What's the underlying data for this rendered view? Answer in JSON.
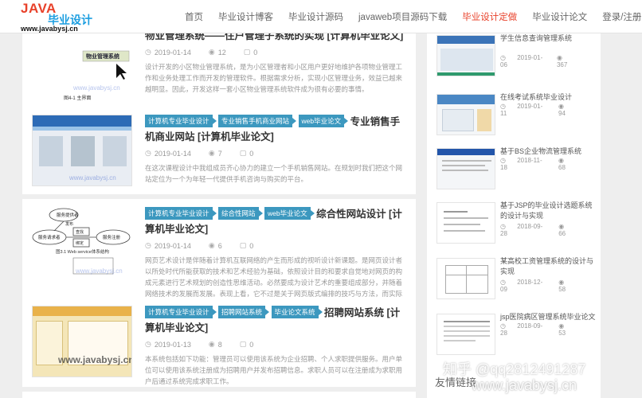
{
  "logo": {
    "brand": "JAVA",
    "name": "毕业设计",
    "site": "www.javabysj.cn"
  },
  "nav": [
    {
      "label": "首页"
    },
    {
      "label": "毕业设计博客"
    },
    {
      "label": "毕业设计源码"
    },
    {
      "label": "javaweb项目源码下载"
    },
    {
      "label": "毕业设计定做"
    },
    {
      "label": "毕业设计论文"
    },
    {
      "label": "登录/注册"
    }
  ],
  "accent": "#e8412a",
  "tag_color": "#3c98bf",
  "articles": [
    {
      "tags": [],
      "title": "物业管理系统——住户管理子系统的实现 [计算机毕业论文]",
      "date": "2019-01-14",
      "views": "12",
      "comments": "0",
      "excerpt": "设计开发的小区物业管理系统，是为小区管理者和小区用户更好地维护各项物业管理工作和业务处理工作而开发的管理软件。根据需求分析，实现小区管理业务，效益已越来越明显。因此，开发这样一套小区物业管理系统软件成为很有必要的事情。",
      "thumb_text": "物业管理系统",
      "thumb_caption": "图4-1 主界面"
    },
    {
      "tags": [
        "计算机专业毕业设计",
        "专业销售手机商业网站",
        "web毕业论文"
      ],
      "title": "专业销售手机商业网站 [计算机毕业论文]",
      "date": "2019-01-14",
      "views": "7",
      "comments": "0",
      "excerpt": "在这次课程设计中我组成员齐心协力的建立一个手机销售网站。在规划时我们把这个网站定位为一个为年轻一代提供手机咨询与购买的平台。"
    },
    {
      "tags": [
        "计算机专业毕业设计",
        "综合性网站",
        "web毕业论文"
      ],
      "title": "综合性网站设计 [计算机毕业论文]",
      "date": "2019-01-14",
      "views": "6",
      "comments": "0",
      "excerpt": "网页艺术设计是伴随着计算机互联网络的产生而形成的视听设计新课题。是网页设计者以所处时代所能获取的技术和艺术经验为基础，依照设计目的和要求自觉地对网页的构成元素进行艺术规划的创造性思维活动。必然要成为设计艺术的重要组成部分，并随着网络技术的发展而发展。表现上看，它不过是关于网页版式编排的技巧与方法，而实际上，它不仅是一种技能，更是艺术与技术的高度统一。",
      "thumb_labels": [
        "服务请求者",
        "服务提供者",
        "服务注册",
        "查找",
        "绑定",
        "发布"
      ],
      "thumb_caption": "图3.1 Web service体系结构"
    },
    {
      "tags": [
        "计算机专业毕业设计",
        "招聘网站系统",
        "毕业论文系统"
      ],
      "title": "招聘网站系统 [计算机毕业论文]",
      "date": "2019-01-13",
      "views": "8",
      "comments": "0",
      "excerpt": "本系统包括如下功能：管理员可以使用该系统为企业招聘、个人求职提供服务。用户单位可以使用该系统注册成为招聘用户并发布招聘信息。求职人员可以在注册成为求职用户后通过系统完成求职工作。"
    }
  ],
  "sidebar": [
    {
      "title": "学生信息查询管理系统",
      "date": "2019-01-06",
      "views": "367"
    },
    {
      "title": "在线考试系统毕业设计",
      "date": "2019-01-11",
      "views": "94"
    },
    {
      "title": "基于BS企业物流管理系统",
      "date": "2018-11-18",
      "views": "68"
    },
    {
      "title": "基于JSP的毕业设计选题系统的设计与实现",
      "date": "2018-09-28",
      "views": "66"
    },
    {
      "title": "某高校工资管理系统的设计与实现",
      "date": "2018-12-09",
      "views": "58"
    },
    {
      "title": "jsp医院病区管理系统毕业论文",
      "date": "2018-09-28",
      "views": "53"
    }
  ],
  "sidebar_footer": "友情链接",
  "watermarks": {
    "line1": "知乎 @qq2812491287",
    "line2": "www.javabysj.cn",
    "thumb": "www.javabysj.cn"
  }
}
